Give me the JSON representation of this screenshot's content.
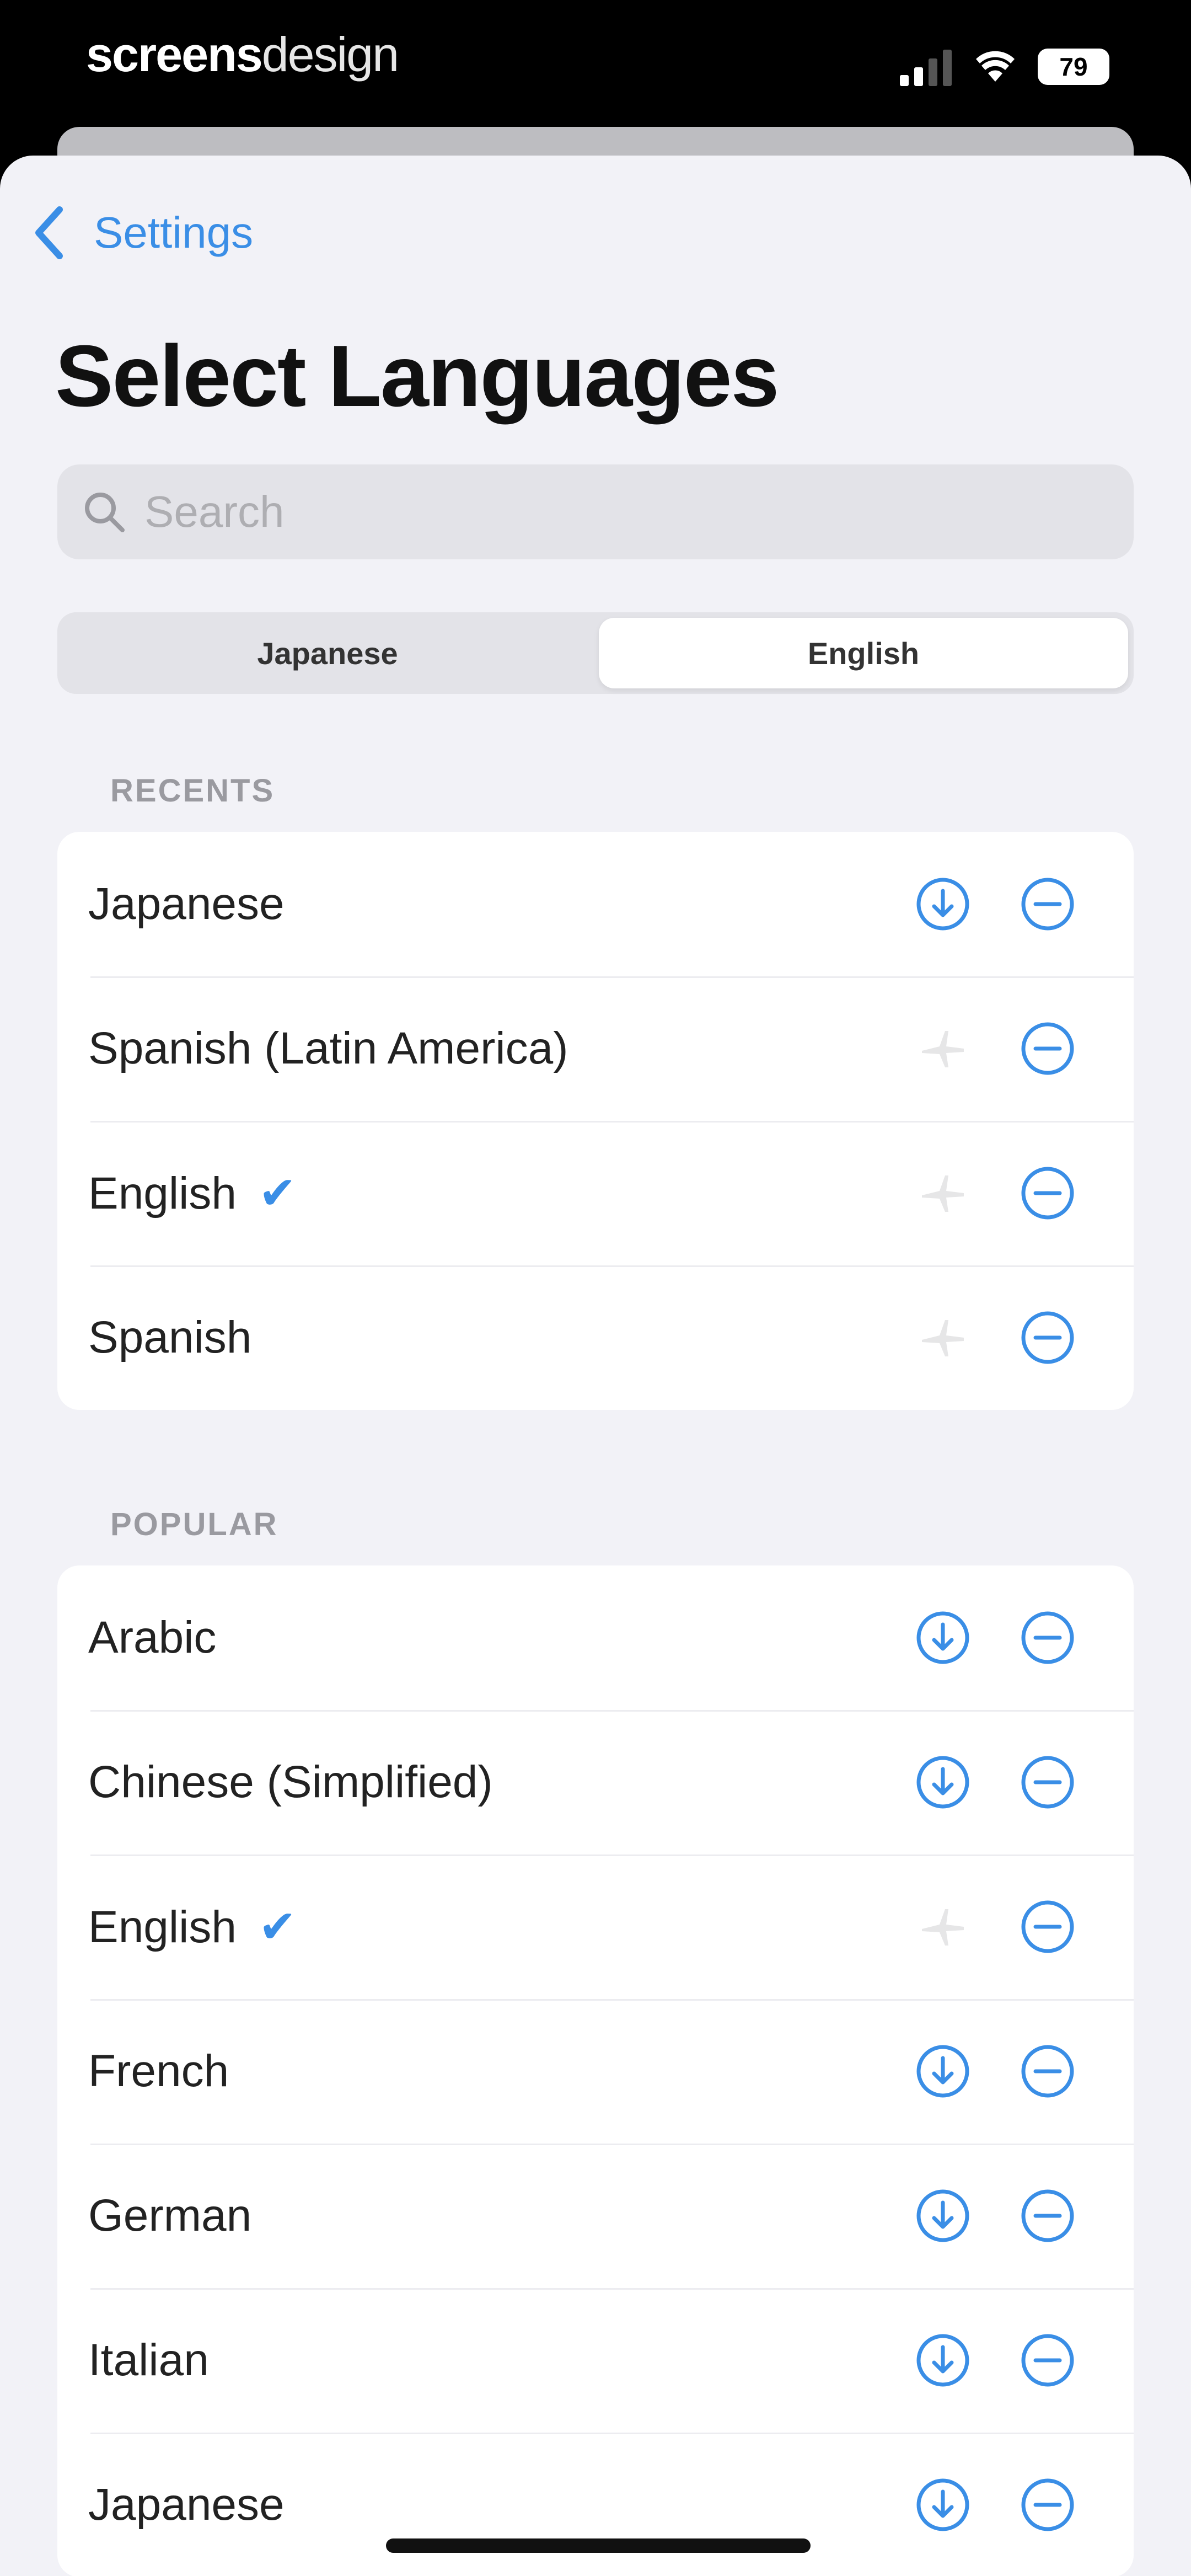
{
  "status_bar": {
    "carrier_bold": "screens",
    "carrier_thin": "design",
    "battery": "79"
  },
  "nav": {
    "back_label": "Settings",
    "title": "Select Languages"
  },
  "search": {
    "placeholder": "Search"
  },
  "segmented": {
    "left": "Japanese",
    "right": "English",
    "selected": "English"
  },
  "recents": {
    "header": "RECENTS",
    "items": [
      {
        "label": "Japanese",
        "downloaded": false,
        "checked": false
      },
      {
        "label": "Spanish (Latin America)",
        "downloaded": true,
        "checked": false
      },
      {
        "label": "English",
        "downloaded": true,
        "checked": true
      },
      {
        "label": "Spanish",
        "downloaded": true,
        "checked": false
      }
    ]
  },
  "popular": {
    "header": "POPULAR",
    "items": [
      {
        "label": "Arabic",
        "downloaded": false,
        "checked": false
      },
      {
        "label": "Chinese (Simplified)",
        "downloaded": false,
        "checked": false
      },
      {
        "label": "English",
        "downloaded": true,
        "checked": true
      },
      {
        "label": "French",
        "downloaded": false,
        "checked": false
      },
      {
        "label": "German",
        "downloaded": false,
        "checked": false
      },
      {
        "label": "Italian",
        "downloaded": false,
        "checked": false
      },
      {
        "label": "Japanese",
        "downloaded": false,
        "checked": false
      }
    ]
  },
  "colors": {
    "accent": "#3a8ee6",
    "background": "#f2f2f7",
    "card": "#ffffff"
  }
}
